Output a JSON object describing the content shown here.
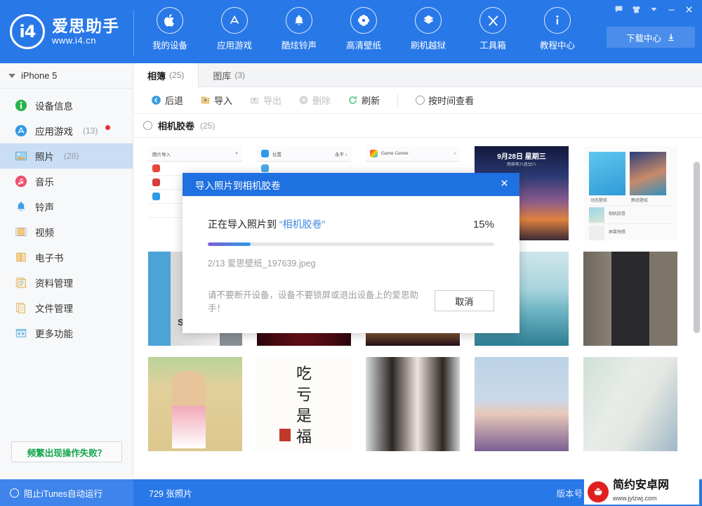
{
  "app": {
    "brand_name": "爱思助手",
    "brand_url": "www.i4.cn",
    "logo_text": "i4"
  },
  "header": {
    "nav": [
      {
        "label": "我的设备",
        "icon": "apple-icon"
      },
      {
        "label": "应用游戏",
        "icon": "appstore-icon"
      },
      {
        "label": "酷炫铃声",
        "icon": "bell-icon"
      },
      {
        "label": "高清壁纸",
        "icon": "flower-icon"
      },
      {
        "label": "刷机越狱",
        "icon": "box-icon"
      },
      {
        "label": "工具箱",
        "icon": "tools-icon"
      },
      {
        "label": "教程中心",
        "icon": "info-icon"
      }
    ],
    "download_center": "下载中心",
    "window_buttons": [
      {
        "name": "feedback-icon",
        "glyph": "message"
      },
      {
        "name": "skin-icon",
        "glyph": "shirt"
      },
      {
        "name": "chevron-down-icon",
        "glyph": "chevron"
      },
      {
        "name": "minimize-icon",
        "glyph": "minimize"
      },
      {
        "name": "close-icon",
        "glyph": "close"
      }
    ]
  },
  "sidebar": {
    "device": "iPhone 5",
    "items": [
      {
        "label": "设备信息",
        "count": "",
        "icon": "info-circle-icon",
        "active": false,
        "dot": false
      },
      {
        "label": "应用游戏",
        "count": "(13)",
        "icon": "appstore-icon",
        "active": false,
        "dot": true
      },
      {
        "label": "照片",
        "count": "(28)",
        "icon": "photo-icon",
        "active": true,
        "dot": false
      },
      {
        "label": "音乐",
        "count": "",
        "icon": "music-icon",
        "active": false,
        "dot": false
      },
      {
        "label": "铃声",
        "count": "",
        "icon": "ringtone-icon",
        "active": false,
        "dot": false
      },
      {
        "label": "视频",
        "count": "",
        "icon": "video-icon",
        "active": false,
        "dot": false
      },
      {
        "label": "电子书",
        "count": "",
        "icon": "book-icon",
        "active": false,
        "dot": false
      },
      {
        "label": "资料管理",
        "count": "",
        "icon": "data-icon",
        "active": false,
        "dot": false
      },
      {
        "label": "文件管理",
        "count": "",
        "icon": "file-icon",
        "active": false,
        "dot": false
      },
      {
        "label": "更多功能",
        "count": "",
        "icon": "more-icon",
        "active": false,
        "dot": false
      }
    ],
    "help_button": "频繁出现操作失败？"
  },
  "main": {
    "tabs": [
      {
        "label": "相簿",
        "count": "(25)",
        "active": true
      },
      {
        "label": "图库",
        "count": "(3)",
        "active": false
      }
    ],
    "toolbar": [
      {
        "label": "后退",
        "icon": "back-icon",
        "disabled": false
      },
      {
        "label": "导入",
        "icon": "import-icon",
        "disabled": false
      },
      {
        "label": "导出",
        "icon": "export-icon",
        "disabled": true
      },
      {
        "label": "删除",
        "icon": "delete-icon",
        "disabled": true
      },
      {
        "label": "刷新",
        "icon": "refresh-icon",
        "disabled": false
      }
    ],
    "view_by_time": "按时间查看",
    "album": {
      "name": "相机胶卷",
      "count": "(25)"
    },
    "photos": [
      {
        "name": "screenshot-photo-import",
        "art": "ios-import"
      },
      {
        "name": "screenshot-settings-location",
        "art": "ios-settings"
      },
      {
        "name": "screenshot-game-center",
        "art": "ios-gamecenter"
      },
      {
        "name": "lockscreen-sunset",
        "art": "sunset",
        "date": "9月28日 星期三",
        "sub": "丙申年八月廿八"
      },
      {
        "name": "screenshot-wallpaper-settings",
        "art": "wallpaper",
        "labels": [
          "动态壁纸",
          "静态壁纸",
          "相机胶卷",
          "屏幕快照"
        ]
      },
      {
        "name": "photo-spurs-jersey",
        "art": "jersey",
        "text": "SPURS"
      },
      {
        "name": "photo-red-car",
        "art": "car"
      },
      {
        "name": "photo-night-city",
        "art": "night"
      },
      {
        "name": "photo-ocean",
        "art": "ocean"
      },
      {
        "name": "photo-man-walking",
        "art": "guy"
      },
      {
        "name": "photo-beach-girl",
        "art": "beach"
      },
      {
        "name": "photo-calligraphy",
        "art": "calligraphy",
        "text": "吃亏是福"
      },
      {
        "name": "photo-long-hair-girl",
        "art": "girl1"
      },
      {
        "name": "photo-girl-hands",
        "art": "girl2"
      },
      {
        "name": "photo-girl-sweater",
        "art": "girl3"
      }
    ]
  },
  "dialog": {
    "title": "导入照片到相机胶卷",
    "status_prefix": "正在导入照片到 ",
    "status_target": "“相机胶卷”",
    "percent": "15%",
    "progress_value": 15,
    "current_file": "2/13 爱思壁纸_197639.jpeg",
    "warning": "请不要断开设备，设备不要锁屏或退出设备上的爱思助手！",
    "cancel": "取消"
  },
  "statusbar": {
    "itunes_toggle": "阻止iTunes自动运行",
    "photo_count": "729 张照片",
    "version_label": "版本号"
  },
  "watermark": {
    "name": "简约安卓网",
    "url": "www.jylzwj.com"
  },
  "colors": {
    "brand_blue": "#2878e8",
    "dialog_blue": "#1f70e0",
    "accent_green": "#13a54d",
    "badge_red": "#ec2f2f",
    "selected_row": "#c9ddf5"
  }
}
